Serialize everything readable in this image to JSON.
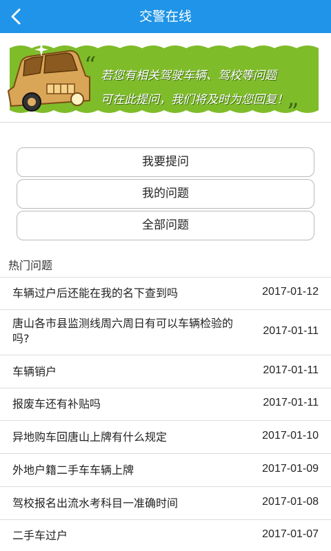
{
  "header": {
    "title": "交警在线"
  },
  "banner": {
    "line1": "若您有相关驾驶车辆、驾校等问题",
    "line2": "可在此提问，我们将及时为您回复！"
  },
  "actions": {
    "ask": "我要提问",
    "mine": "我的问题",
    "all": "全部问题"
  },
  "hot": {
    "title": "热门问题",
    "items": [
      {
        "question": "车辆过户后还能在我的名下查到吗",
        "date": "2017-01-12"
      },
      {
        "question": "唐山各市县监测线周六周日有可以车辆检验的吗?",
        "date": "2017-01-11"
      },
      {
        "question": "车辆销户",
        "date": "2017-01-11"
      },
      {
        "question": "报废车还有补贴吗",
        "date": "2017-01-11"
      },
      {
        "question": "异地购车回唐山上牌有什么规定",
        "date": "2017-01-10"
      },
      {
        "question": "外地户籍二手车车辆上牌",
        "date": "2017-01-09"
      },
      {
        "question": "驾校报名出流水考科目一准确时间",
        "date": "2017-01-08"
      },
      {
        "question": "二手车过户",
        "date": "2017-01-07"
      }
    ]
  },
  "colors": {
    "header": "#1f94e8",
    "banner_green": "#7fbc2a",
    "car": "#d9a557"
  }
}
